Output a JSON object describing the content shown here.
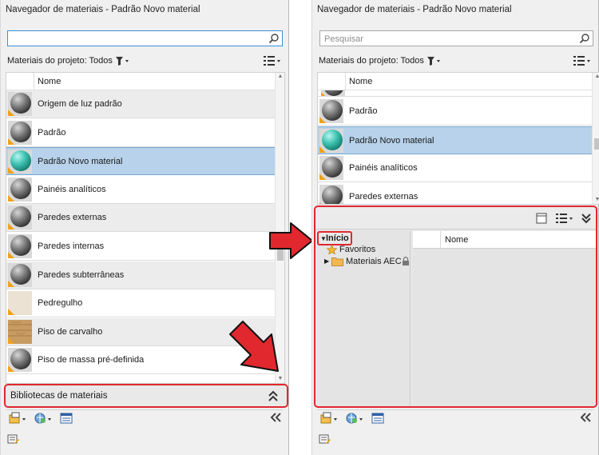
{
  "left": {
    "title": "Navegador de materiais - Padrão Novo material",
    "search_value": "",
    "filter_label": "Materiais do projeto: Todos",
    "column_name": "Nome",
    "rows": [
      {
        "label": "Origem de luz padrão",
        "swatch": "sphere-gray",
        "state": "alt"
      },
      {
        "label": "Padrão",
        "swatch": "sphere-gray",
        "state": ""
      },
      {
        "label": "Padrão Novo material",
        "swatch": "sphere-teal",
        "state": "sel"
      },
      {
        "label": "Painéis analíticos",
        "swatch": "sphere-gray",
        "state": ""
      },
      {
        "label": "Paredes externas",
        "swatch": "sphere-gray",
        "state": "alt"
      },
      {
        "label": "Paredes internas",
        "swatch": "sphere-gray",
        "state": ""
      },
      {
        "label": "Paredes subterrâneas",
        "swatch": "sphere-gray",
        "state": "alt"
      },
      {
        "label": "Pedregulho",
        "swatch": "flat-beige",
        "state": ""
      },
      {
        "label": "Piso de carvalho",
        "swatch": "wood",
        "state": "alt"
      },
      {
        "label": "Piso de massa pré-definida",
        "swatch": "sphere-gray",
        "state": ""
      }
    ],
    "library_bar_label": "Bibliotecas de materiais"
  },
  "right": {
    "title": "Navegador de materiais - Padrão Novo material",
    "search_placeholder": "Pesquisar",
    "filter_label": "Materiais do projeto: Todos",
    "column_name": "Nome",
    "rows": [
      {
        "label": "Padrão",
        "swatch": "sphere-gray",
        "state": ""
      },
      {
        "label": "Padrão Novo material",
        "swatch": "sphere-teal",
        "state": "sel"
      },
      {
        "label": "Painéis analíticos",
        "swatch": "sphere-gray",
        "state": ""
      },
      {
        "label": "Paredes externas",
        "swatch": "sphere-gray",
        "state": ""
      }
    ],
    "library": {
      "root_label": "Início",
      "favorites_label": "Favoritos",
      "aec_label": "Materiais AEC",
      "column_name": "Nome"
    }
  },
  "colors": {
    "highlight": "#e0282e",
    "selection": "#b7d2ea",
    "panel_bg": "#f0f0f0"
  },
  "icons": [
    "search-icon",
    "funnel-icon",
    "list-view-icon",
    "double-chevron-up-icon",
    "new-material-icon",
    "globe-icon",
    "material-editor-icon",
    "collapse-left-icon",
    "status-icon",
    "single-pane-icon",
    "list-view-icon",
    "double-chevron-down-icon",
    "star-icon",
    "folder-icon",
    "lock-icon"
  ]
}
